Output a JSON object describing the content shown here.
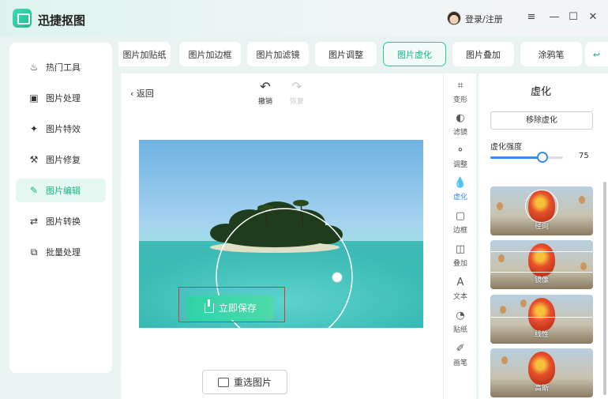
{
  "app": {
    "title": "迅捷抠图",
    "login": "登录/注册"
  },
  "window": {
    "menu": "≡",
    "minimize": "—",
    "maximize": "☐",
    "close": "✕"
  },
  "sidebar": {
    "items": [
      {
        "label": "热门工具",
        "icon": "flame-icon",
        "glyph": "♨"
      },
      {
        "label": "图片处理",
        "icon": "image-edit-icon",
        "glyph": "▣"
      },
      {
        "label": "图片特效",
        "icon": "sparkle-icon",
        "glyph": "✦"
      },
      {
        "label": "图片修复",
        "icon": "wrench-icon",
        "glyph": "⚒"
      },
      {
        "label": "图片编辑",
        "icon": "edit-icon",
        "glyph": "✎",
        "active": true
      },
      {
        "label": "图片转换",
        "icon": "convert-icon",
        "glyph": "⇄"
      },
      {
        "label": "批量处理",
        "icon": "batch-icon",
        "glyph": "⧉"
      }
    ]
  },
  "tabs": [
    {
      "label": "图片加贴纸"
    },
    {
      "label": "图片加边框"
    },
    {
      "label": "图片加滤镜"
    },
    {
      "label": "图片调整"
    },
    {
      "label": "图片虚化",
      "active": true
    },
    {
      "label": "图片叠加"
    },
    {
      "label": "涂鸦笔"
    },
    {
      "label": "↩"
    }
  ],
  "editor": {
    "back": "返回",
    "undo": {
      "label": "撤销",
      "glyph": "↶"
    },
    "redo": {
      "label": "恢复",
      "glyph": "↷"
    },
    "reselect": "重选图片",
    "save": "立即保存"
  },
  "tools": [
    {
      "label": "变形",
      "glyph": "⌗",
      "icon": "crop-icon"
    },
    {
      "label": "滤镜",
      "glyph": "◐",
      "icon": "filter-icon"
    },
    {
      "label": "调整",
      "glyph": "⚬",
      "icon": "adjust-icon"
    },
    {
      "label": "虚化",
      "glyph": "💧",
      "icon": "blur-drop-icon",
      "active": true
    },
    {
      "label": "边框",
      "glyph": "▢",
      "icon": "frame-icon"
    },
    {
      "label": "叠加",
      "glyph": "◫",
      "icon": "overlay-icon"
    },
    {
      "label": "文本",
      "glyph": "A",
      "icon": "text-icon"
    },
    {
      "label": "贴纸",
      "glyph": "◔",
      "icon": "sticker-icon"
    },
    {
      "label": "画笔",
      "glyph": "✐",
      "icon": "brush-icon"
    }
  ],
  "panel": {
    "title": "虚化",
    "remove": "移除虚化",
    "intensity_label": "虚化强度",
    "intensity_value": "75",
    "intensity_fraction": 0.72,
    "presets": [
      {
        "label": "径向",
        "kind": "radial"
      },
      {
        "label": "镜像",
        "kind": "mirror"
      },
      {
        "label": "线性",
        "kind": "linear"
      },
      {
        "label": "高斯",
        "kind": "gaussian"
      }
    ]
  },
  "colors": {
    "accent": "#19b58a",
    "blue": "#3a8ef0",
    "save_border": "#d93b32"
  }
}
